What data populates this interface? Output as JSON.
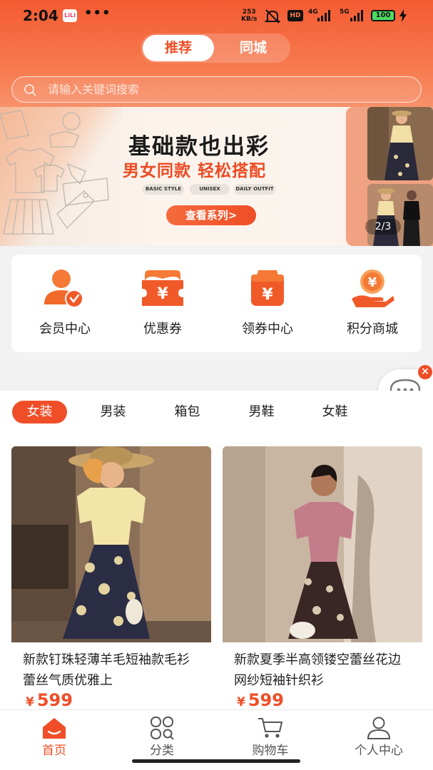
{
  "status_bar": {
    "time": "2:04",
    "app_badge": "LiLi",
    "more": "•••",
    "net_speed_value": "253",
    "net_speed_unit": "KB/s",
    "hd_label": "HD",
    "net1": "4G",
    "net2": "5G",
    "battery": "100"
  },
  "top_tabs": {
    "active": "推荐",
    "inactive": "同城"
  },
  "search": {
    "placeholder": "请输入关键词搜索"
  },
  "banner": {
    "title": "基础款也出彩",
    "subtitle": "男女同款 轻松搭配",
    "tags": [
      "BASIC STYLE",
      "UNISEX",
      "DAILY OUTFIT"
    ],
    "button": "查看系列>",
    "pager": "2/3"
  },
  "quick_links": [
    {
      "label": "会员中心",
      "icon": "member-icon"
    },
    {
      "label": "优惠券",
      "icon": "coupon-icon"
    },
    {
      "label": "领券中心",
      "icon": "coupon-center-icon"
    },
    {
      "label": "积分商城",
      "icon": "points-mall-icon"
    }
  ],
  "categories": {
    "items": [
      "女装",
      "男装",
      "箱包",
      "男鞋",
      "女鞋"
    ],
    "active_index": 0
  },
  "products": [
    {
      "title": "新款钉珠轻薄羊毛短袖款毛衫蕾丝气质优雅上",
      "currency": "¥",
      "price": "599"
    },
    {
      "title": "新款夏季半高领镂空蕾丝花边网纱短袖针织衫",
      "currency": "¥",
      "price": "599"
    }
  ],
  "chat": {
    "close": "×"
  },
  "tabbar": {
    "items": [
      "首页",
      "分类",
      "购物车",
      "个人中心"
    ],
    "active_index": 0
  },
  "colors": {
    "accent": "#f04e28",
    "header_gradient_top": "#f45a32",
    "header_gradient_bottom": "#f8916a"
  }
}
